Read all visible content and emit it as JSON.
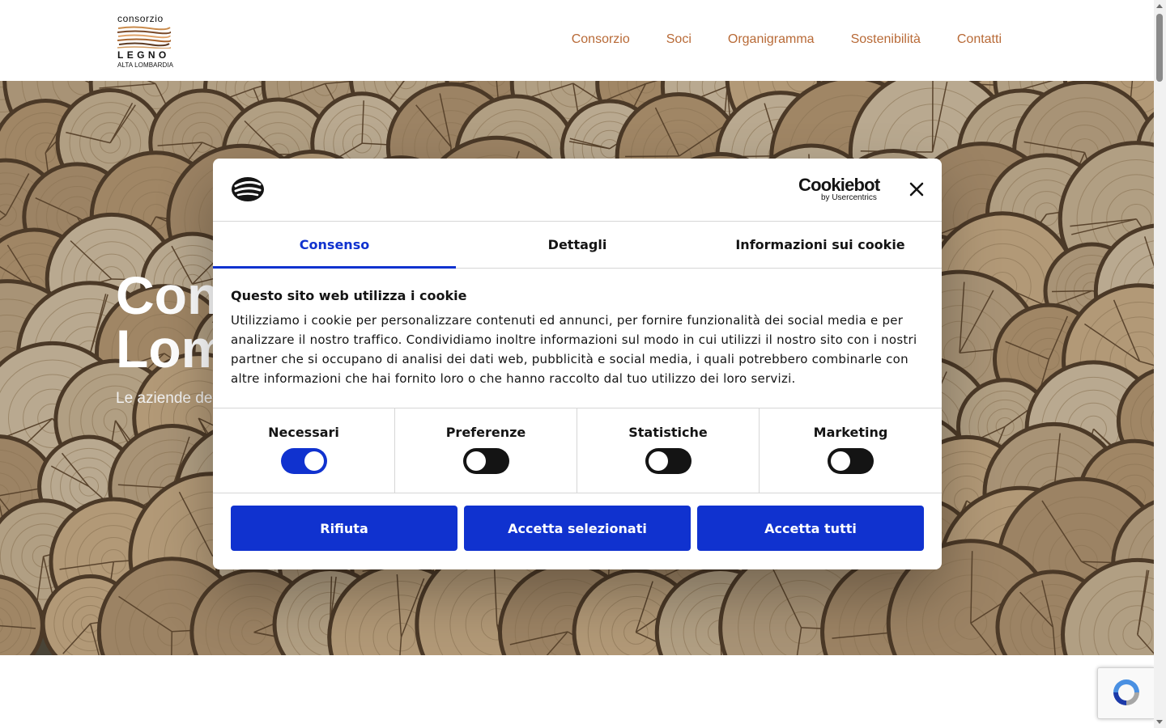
{
  "header": {
    "logo": {
      "top": "consorzio",
      "middle": "LEGNO",
      "bottom": "ALTA LOMBARDIA"
    },
    "nav": [
      {
        "label": "Consorzio"
      },
      {
        "label": "Soci"
      },
      {
        "label": "Organigramma"
      },
      {
        "label": "Sostenibilità"
      },
      {
        "label": "Contatti"
      }
    ],
    "nav_color": "#b86a37"
  },
  "hero": {
    "title": "Con\nLom",
    "subtitle": "Le aziende de"
  },
  "cookie_dialog": {
    "brand": {
      "name": "Cookiebot",
      "byline": "by Usercentrics"
    },
    "close_icon": "close-icon",
    "tabs": [
      {
        "label": "Consenso",
        "active": true
      },
      {
        "label": "Dettagli",
        "active": false
      },
      {
        "label": "Informazioni sui cookie",
        "active": false
      }
    ],
    "heading": "Questo sito web utilizza i cookie",
    "body": "Utilizziamo i cookie per personalizzare contenuti ed annunci, per fornire funzionalità dei social media e per analizzare il nostro traffico. Condividiamo inoltre informazioni sul modo in cui utilizzi il nostro sito con i nostri partner che si occupano di analisi dei dati web, pubblicità e social media, i quali potrebbero combinarle con altre informazioni che hai fornito loro o che hanno raccolto dal tuo utilizzo dei loro servizi.",
    "toggles": [
      {
        "label": "Necessari",
        "checked": true
      },
      {
        "label": "Preferenze",
        "checked": false
      },
      {
        "label": "Statistiche",
        "checked": false
      },
      {
        "label": "Marketing",
        "checked": false
      }
    ],
    "buttons": [
      {
        "label": "Rifiuta"
      },
      {
        "label": "Accetta selezionati"
      },
      {
        "label": "Accetta tutti"
      }
    ],
    "accent_color": "#1032cf"
  },
  "recaptcha": {
    "icon": "recaptcha-icon"
  }
}
